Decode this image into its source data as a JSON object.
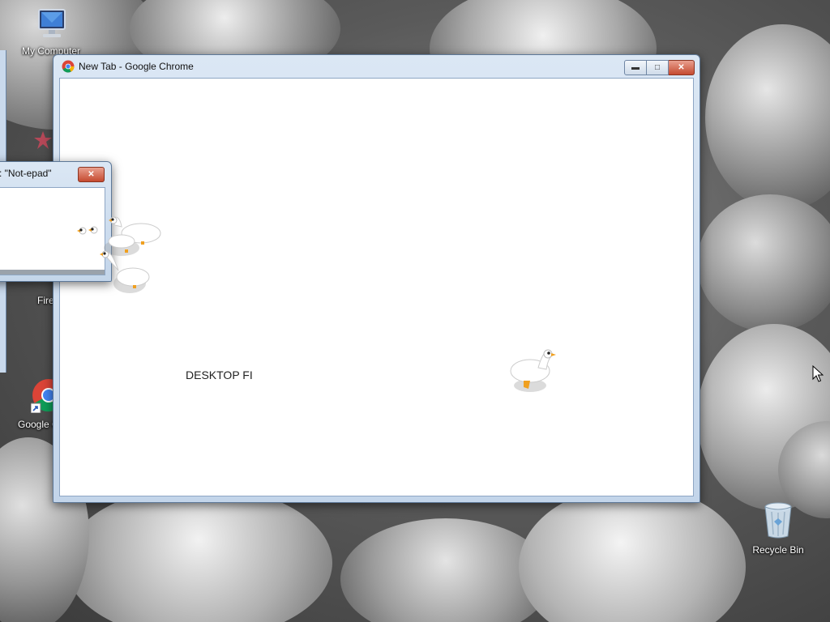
{
  "desktop": {
    "icons": [
      {
        "label": "My Computer",
        "icon": "computer-icon"
      },
      {
        "label": "Fire",
        "icon": "firefox-icon"
      },
      {
        "label": "Google C",
        "icon": "chrome-icon"
      },
      {
        "label": "Recycle Bin",
        "icon": "recycle-bin-icon"
      }
    ]
  },
  "chrome_window": {
    "title": "New Tab - Google Chrome",
    "page_text": "DESKTOP FI",
    "buttons": {
      "minimize": "minimize-icon",
      "maximize": "maximize-icon",
      "close": "close-icon"
    }
  },
  "notepad_window": {
    "title": ": \"Not-epad\""
  },
  "colors": {
    "title_bar": "#c3d5ea",
    "close_button": "#c54a30",
    "goose_beak": "#f0a020"
  }
}
